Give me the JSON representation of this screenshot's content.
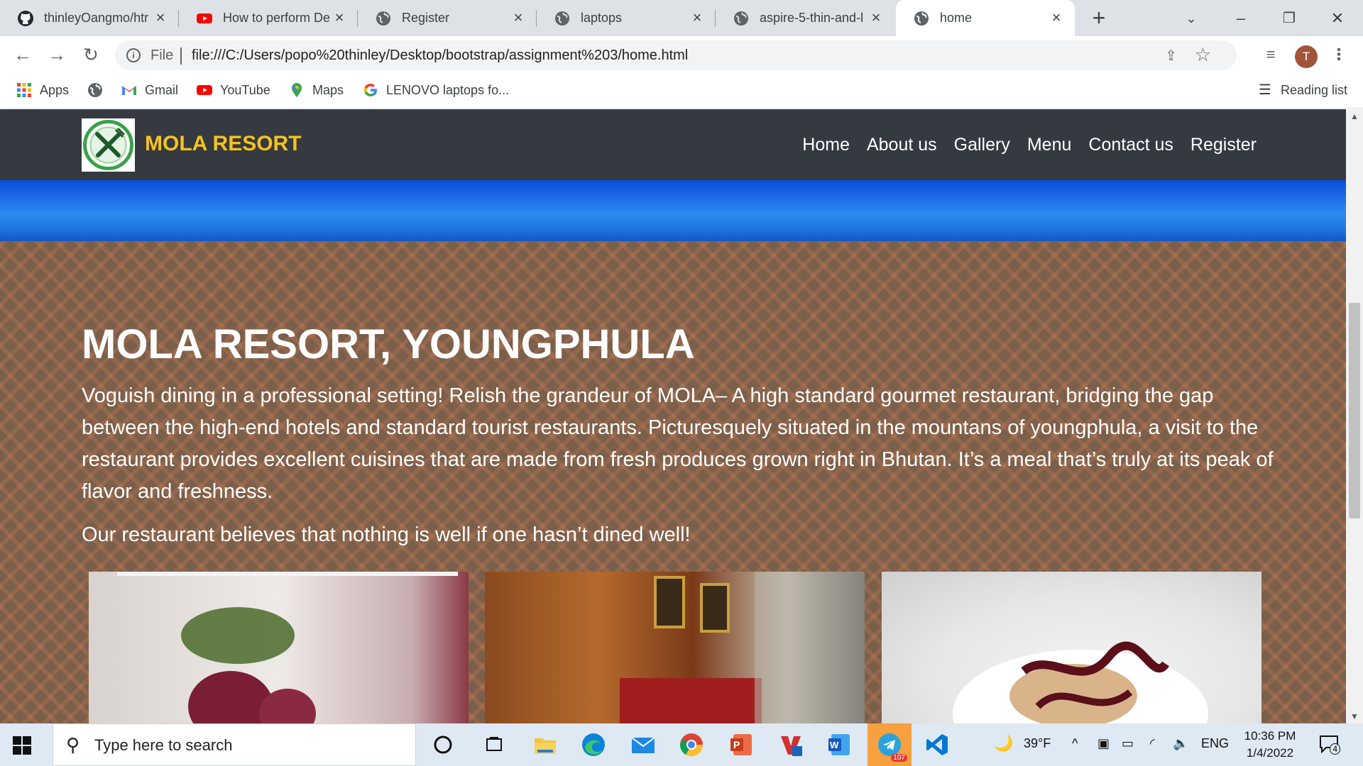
{
  "browser": {
    "tabs": [
      {
        "title": "thinleyOangmo/htr",
        "icon": "github-icon"
      },
      {
        "title": "How to perform De",
        "icon": "youtube-icon"
      },
      {
        "title": "Register",
        "icon": "globe-icon"
      },
      {
        "title": "laptops",
        "icon": "globe-icon"
      },
      {
        "title": "aspire-5-thin-and-l",
        "icon": "globe-icon"
      },
      {
        "title": "home",
        "icon": "globe-icon",
        "active": true
      }
    ],
    "address": {
      "scheme_label": "File",
      "url": "file:///C:/Users/popo%20thinley/Desktop/bootstrap/assignment%203/home.html"
    },
    "profile_initial": "T",
    "bookmarks": [
      {
        "label": "Apps",
        "icon": "apps-grid-icon"
      },
      {
        "label": "",
        "icon": "globe-icon"
      },
      {
        "label": "Gmail",
        "icon": "gmail-icon"
      },
      {
        "label": "YouTube",
        "icon": "youtube-icon"
      },
      {
        "label": "Maps",
        "icon": "maps-icon"
      },
      {
        "label": "LENOVO laptops fo...",
        "icon": "google-icon"
      }
    ],
    "reading_list": "Reading list"
  },
  "site": {
    "brand": "MOLA RESORT",
    "nav": [
      "Home",
      "About us",
      "Gallery",
      "Menu",
      "Contact us",
      "Register"
    ],
    "heading": "MOLA RESORT, YOUNGPHULA",
    "paragraph1": "Voguish dining in a professional setting! Relish the grandeur of MOLA– A high standard gourmet restaurant, bridging the gap between the high-end hotels and standard tourist restaurants. Picturesquely situated in the mountans of youngphula, a visit to the restaurant provides excellent cuisines that are made from fresh produces grown right in Bhutan. It’s a meal that’s truly at its peak of flavor and freshness.",
    "paragraph2": "Our restaurant believes that nothing is well if one hasn’t dined well!",
    "colors": {
      "navbar": "#343a40",
      "brand": "#f6c21f",
      "hero": "#7a5f4a"
    }
  },
  "taskbar": {
    "search_placeholder": "Type here to search",
    "weather": "39°F",
    "language": "ENG",
    "time": "10:36 PM",
    "date": "1/4/2022",
    "notifications": "4",
    "telegram_badge": "107"
  }
}
